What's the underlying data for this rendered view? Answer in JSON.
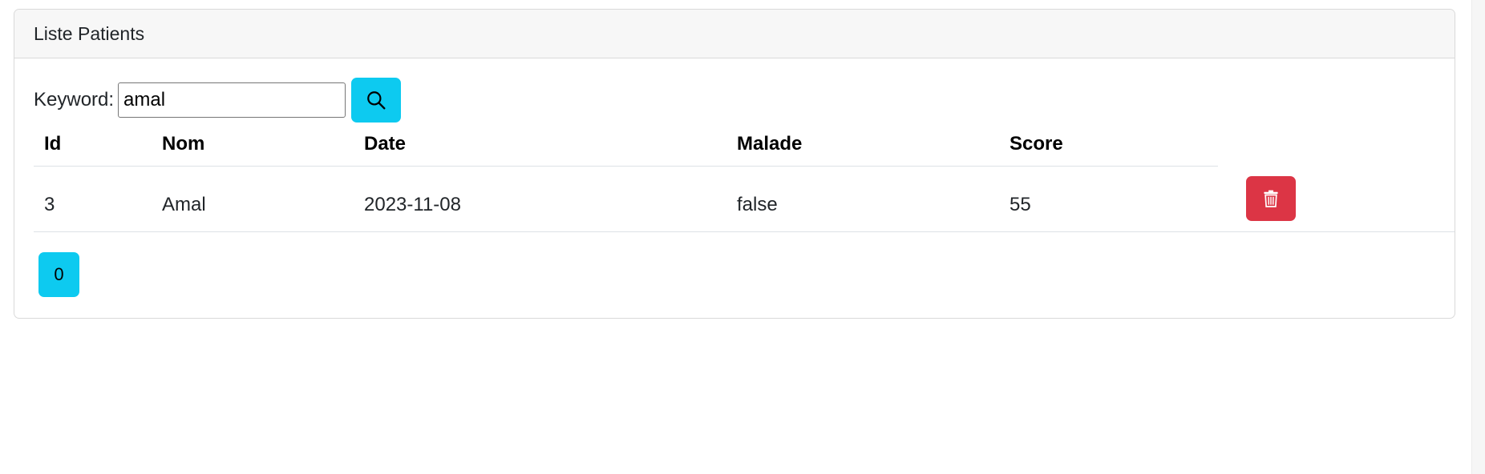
{
  "card": {
    "title": "Liste Patients"
  },
  "search": {
    "label": "Keyword:",
    "value": "amal",
    "button_icon": "search-icon"
  },
  "table": {
    "columns": [
      "Id",
      "Nom",
      "Date",
      "Malade",
      "Score"
    ],
    "rows": [
      {
        "id": "3",
        "nom": "Amal",
        "date": "2023-11-08",
        "malade": "false",
        "score": "55",
        "action_icon": "trash-icon"
      }
    ]
  },
  "pagination": {
    "pages": [
      "0"
    ],
    "current": "0"
  },
  "colors": {
    "info": "#0dcaf0",
    "danger": "#dc3545",
    "header_bg": "#f7f7f7",
    "border": "#dee2e6"
  }
}
